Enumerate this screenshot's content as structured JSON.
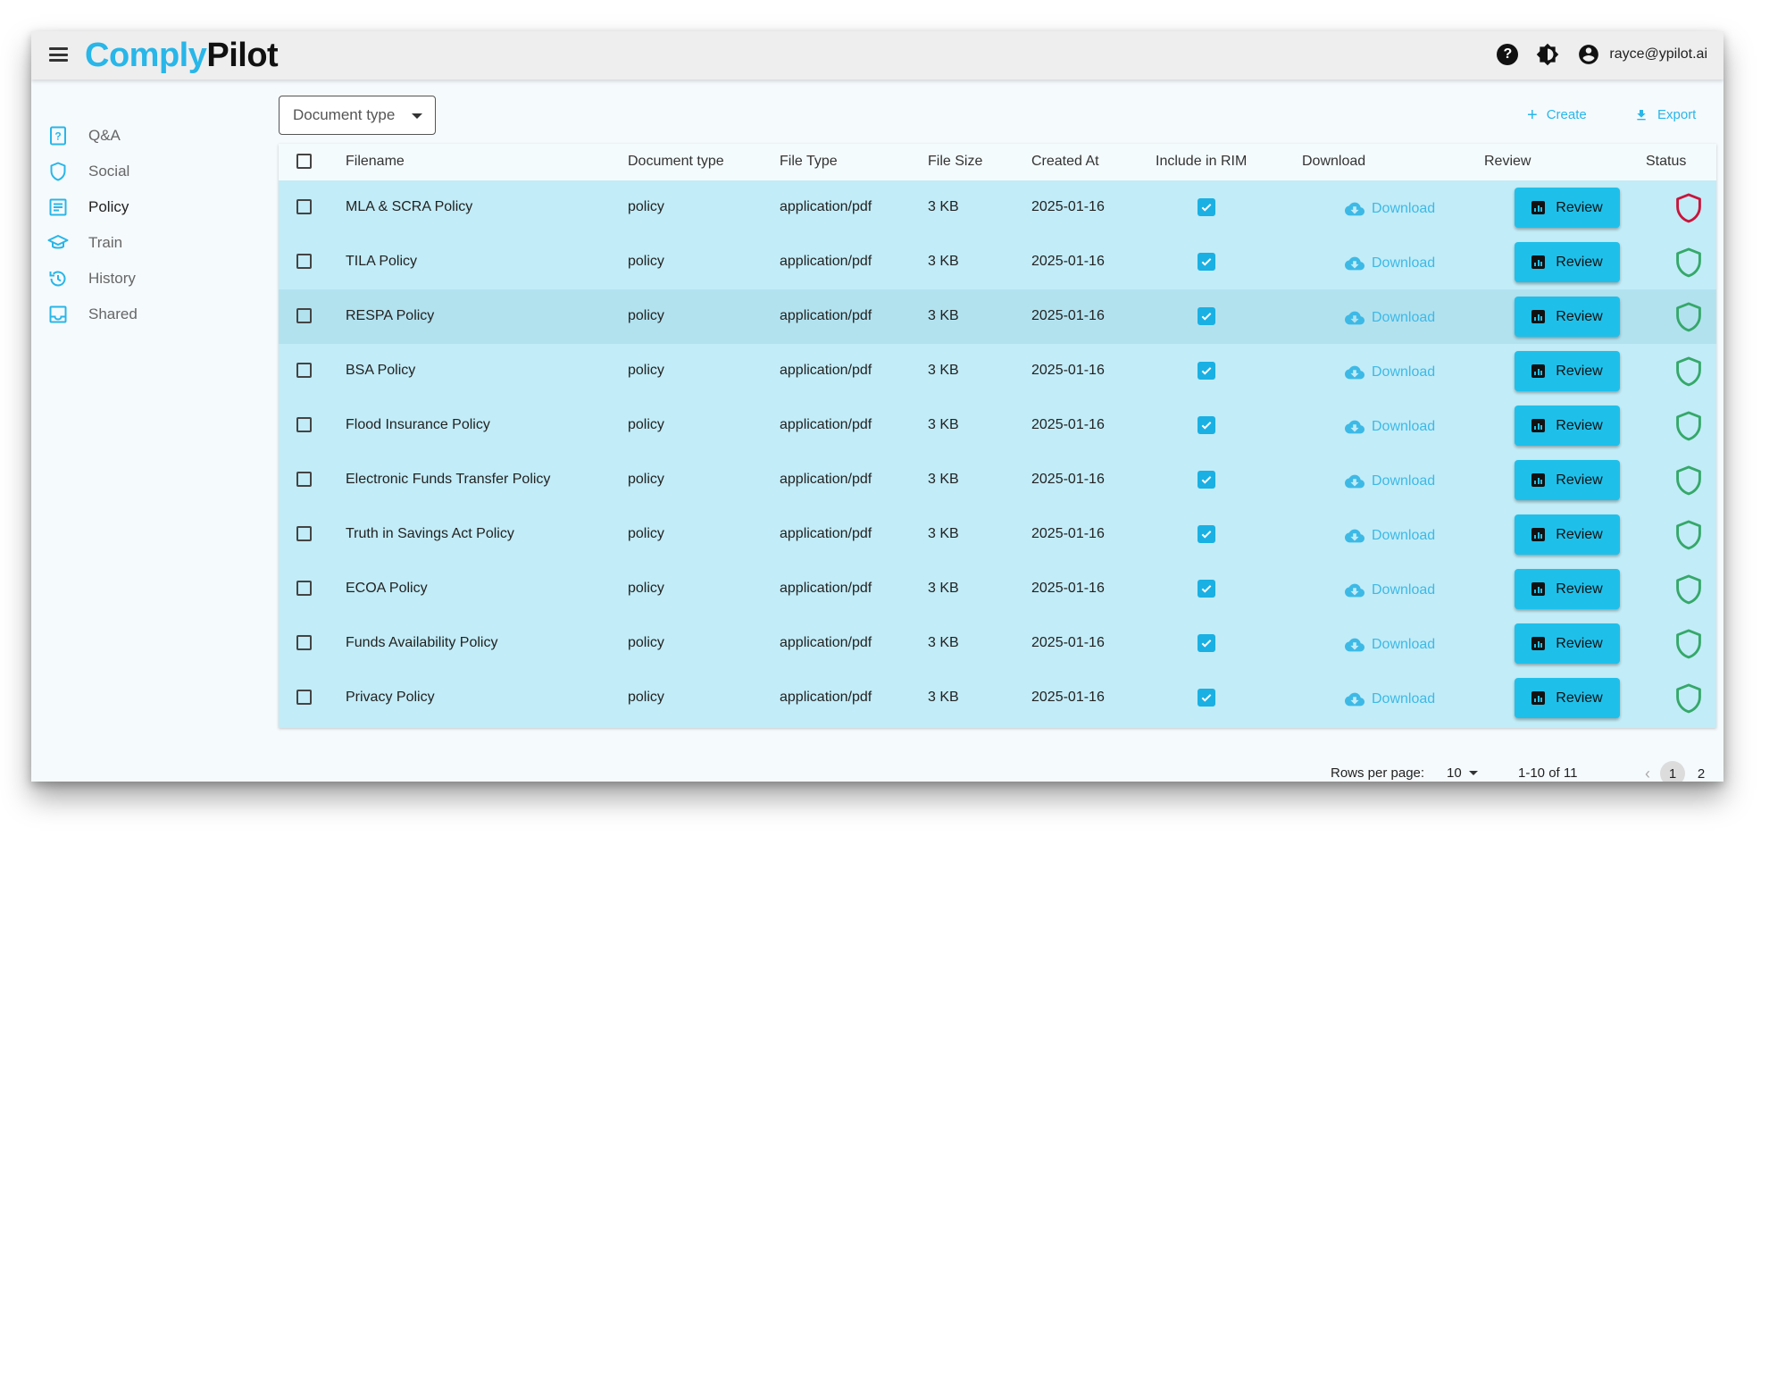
{
  "app": {
    "logo_part1": "Comply",
    "logo_part2": "Pilot"
  },
  "header": {
    "user_email": "rayce@ypilot.ai",
    "help_icon": "help-icon",
    "theme_icon": "theme-toggle-icon",
    "account_icon": "account-icon"
  },
  "sidebar": {
    "items": [
      {
        "label": "Q&A",
        "icon": "qa-icon",
        "active": false
      },
      {
        "label": "Social",
        "icon": "shield-icon",
        "active": false
      },
      {
        "label": "Policy",
        "icon": "document-icon",
        "active": true
      },
      {
        "label": "Train",
        "icon": "graduation-cap-icon",
        "active": false
      },
      {
        "label": "History",
        "icon": "history-icon",
        "active": false
      },
      {
        "label": "Shared",
        "icon": "inbox-icon",
        "active": false
      }
    ]
  },
  "toolbar": {
    "filter_label": "Document type",
    "create_label": "Create",
    "export_label": "Export"
  },
  "table": {
    "columns": [
      "Filename",
      "Document type",
      "File Type",
      "File Size",
      "Created At",
      "Include in RIM",
      "Download",
      "Review",
      "Status"
    ],
    "download_label": "Download",
    "review_label": "Review",
    "rows": [
      {
        "filename": "MLA & SCRA Policy",
        "doc_type": "policy",
        "file_type": "application/pdf",
        "file_size": "3 KB",
        "created_at": "2025-01-16",
        "include_rim": true,
        "status": "alert"
      },
      {
        "filename": "TILA Policy",
        "doc_type": "policy",
        "file_type": "application/pdf",
        "file_size": "3 KB",
        "created_at": "2025-01-16",
        "include_rim": true,
        "status": "ok"
      },
      {
        "filename": "RESPA Policy",
        "doc_type": "policy",
        "file_type": "application/pdf",
        "file_size": "3 KB",
        "created_at": "2025-01-16",
        "include_rim": true,
        "status": "ok"
      },
      {
        "filename": "BSA Policy",
        "doc_type": "policy",
        "file_type": "application/pdf",
        "file_size": "3 KB",
        "created_at": "2025-01-16",
        "include_rim": true,
        "status": "ok"
      },
      {
        "filename": "Flood Insurance Policy",
        "doc_type": "policy",
        "file_type": "application/pdf",
        "file_size": "3 KB",
        "created_at": "2025-01-16",
        "include_rim": true,
        "status": "ok"
      },
      {
        "filename": "Electronic Funds Transfer Policy",
        "doc_type": "policy",
        "file_type": "application/pdf",
        "file_size": "3 KB",
        "created_at": "2025-01-16",
        "include_rim": true,
        "status": "ok"
      },
      {
        "filename": "Truth in Savings Act Policy",
        "doc_type": "policy",
        "file_type": "application/pdf",
        "file_size": "3 KB",
        "created_at": "2025-01-16",
        "include_rim": true,
        "status": "ok"
      },
      {
        "filename": "ECOA Policy",
        "doc_type": "policy",
        "file_type": "application/pdf",
        "file_size": "3 KB",
        "created_at": "2025-01-16",
        "include_rim": true,
        "status": "ok"
      },
      {
        "filename": "Funds Availability Policy",
        "doc_type": "policy",
        "file_type": "application/pdf",
        "file_size": "3 KB",
        "created_at": "2025-01-16",
        "include_rim": true,
        "status": "ok"
      },
      {
        "filename": "Privacy Policy",
        "doc_type": "policy",
        "file_type": "application/pdf",
        "file_size": "3 KB",
        "created_at": "2025-01-16",
        "include_rim": true,
        "status": "ok"
      }
    ]
  },
  "pagination": {
    "rows_per_page_label": "Rows per page:",
    "rows_per_page": "10",
    "range": "1-10 of 11",
    "pages": [
      "1",
      "2"
    ],
    "current_page": "1"
  },
  "colors": {
    "accent": "#29b6e8",
    "review_button": "#1ec0ea",
    "status_ok": "#35a86a",
    "status_alert": "#c8163c",
    "row_bg": "#c2ecf7"
  }
}
